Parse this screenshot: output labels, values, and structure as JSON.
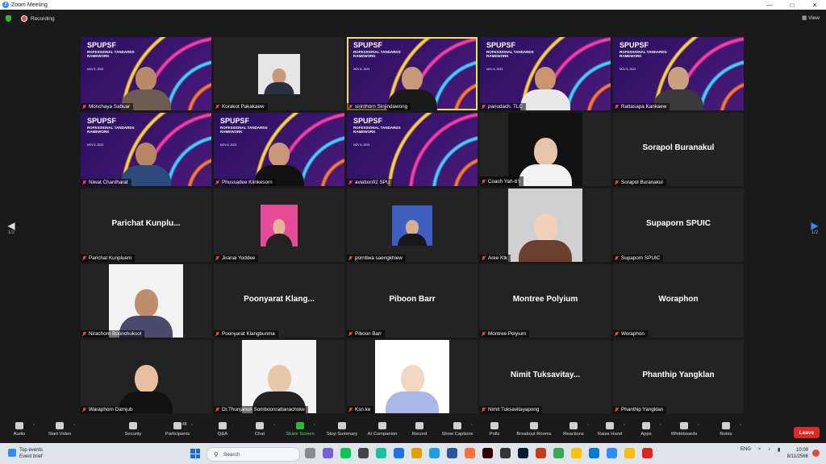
{
  "window": {
    "title": "Zoom Meeting"
  },
  "topbar": {
    "recording_label": "Recording",
    "view_label": "View"
  },
  "pager": {
    "page": "1/2"
  },
  "spu_banner": {
    "title": "SPUPSF",
    "subtitle": "ROFESSIONAL TANDARDS RAMEWORK",
    "date": "NOV 6, 2023"
  },
  "participants": [
    {
      "name": "Monchaya Sabuar",
      "kind": "spu",
      "person": {
        "skin": "#b98a6a",
        "shirt": "#6b5b50"
      }
    },
    {
      "name": "Korakot Pakakaew",
      "kind": "photo",
      "photo": {
        "w": 52,
        "h": 50,
        "bg": "#e6e6e6",
        "skin": "#c79a7a",
        "shirt": "#2a3240"
      }
    },
    {
      "name": "sirinthorn Sinjindawong",
      "kind": "spu",
      "active": true,
      "person": {
        "skin": "#c89a7a",
        "shirt": "#1a1a1a"
      }
    },
    {
      "name": "panudach. TLC",
      "kind": "spu",
      "person": {
        "skin": "#c8956f",
        "shirt": "#e8e8e8"
      }
    },
    {
      "name": "Rattasapa Kankaew",
      "kind": "spu",
      "person": {
        "skin": "#caa080",
        "shirt": "#3a3a3a"
      }
    },
    {
      "name": "Niwat Chantharat",
      "kind": "spu",
      "person": {
        "skin": "#b88563",
        "shirt": "#2d4a7a"
      }
    },
    {
      "name": "Phussadee Klinkesorn",
      "kind": "spu",
      "person": {
        "skin": "#c89878",
        "shirt": "#111111"
      }
    },
    {
      "name": "aviation02 SPU",
      "kind": "spu"
    },
    {
      "name": "Coach Yah-ยา",
      "kind": "photo",
      "photo": {
        "w": 92,
        "h": 91,
        "bg": "#111111",
        "skin": "#e8c4a8",
        "shirt": "#f2f2f2"
      }
    },
    {
      "name": "Sorapol Buranakul",
      "kind": "name",
      "big": "Sorapol Buranakul"
    },
    {
      "name": "Parichat Kunpluem",
      "kind": "name",
      "big": "Parichat  Kunplu..."
    },
    {
      "name": "Jiranai Yoddee",
      "kind": "photo",
      "photo": {
        "w": 46,
        "h": 52,
        "bg": "#e84a9a",
        "skin": "#e0b898",
        "shirt": "#222222"
      }
    },
    {
      "name": "porntiwa saengkhiew",
      "kind": "photo",
      "photo": {
        "w": 50,
        "h": 50,
        "bg": "#4060c0",
        "skin": "#d8b090",
        "shirt": "#181818"
      }
    },
    {
      "name": "Aree Ktk",
      "kind": "photo",
      "photo": {
        "w": 92,
        "h": 91,
        "bg": "#d0d0d0",
        "skin": "#f0d0b8",
        "shirt": "#6a4030"
      }
    },
    {
      "name": "Supaporn SPUIC",
      "kind": "name",
      "big": "Supaporn SPUIC"
    },
    {
      "name": "Nirachorn Boonchuksol",
      "kind": "photo",
      "photo": {
        "w": 92,
        "h": 91,
        "bg": "#f2f2f2",
        "skin": "#c08e6e",
        "shirt": "#4a4a6a"
      }
    },
    {
      "name": "Poonyarat Klangbunma",
      "kind": "name",
      "big": "Poonyarat  Klang..."
    },
    {
      "name": "Piboon Barr",
      "kind": "name",
      "big": "Piboon Barr"
    },
    {
      "name": "Montree Polyium",
      "kind": "name",
      "big": "Montree Polyium"
    },
    {
      "name": "Woraphon",
      "kind": "name",
      "big": "Woraphon"
    },
    {
      "name": "Waraphorn Damjub",
      "kind": "photo",
      "photo": {
        "w": 92,
        "h": 91,
        "bg": "#222222",
        "skin": "#e8c0a0",
        "shirt": "#111111"
      }
    },
    {
      "name": "Dr.Thunjanun Somboonrattanachoke",
      "kind": "photo",
      "photo": {
        "w": 92,
        "h": 91,
        "bg": "#f4f4f4",
        "skin": "#e8c6a8",
        "shirt": "#222222"
      }
    },
    {
      "name": "Ksn.ke",
      "kind": "photo",
      "photo": {
        "w": 92,
        "h": 91,
        "bg": "#ffffff",
        "skin": "#f2d6c0",
        "shirt": "#a8b8e8"
      }
    },
    {
      "name": "Nimit Tuksavitayapong",
      "kind": "name",
      "big": "Nimit  Tuksavitay..."
    },
    {
      "name": "Phanthip Yangklan",
      "kind": "name",
      "big": "Phanthip Yangklan"
    }
  ],
  "toolbar": [
    {
      "key": "audio",
      "label": "Audio",
      "icon": "microphone-icon",
      "caret": true
    },
    {
      "key": "video",
      "label": "Start Video",
      "icon": "video-camera-icon",
      "caret": true
    },
    {
      "key": "security",
      "label": "Security",
      "icon": "shield-icon"
    },
    {
      "key": "participants",
      "label": "Participants",
      "icon": "participants-icon",
      "count": "48",
      "caret": true
    },
    {
      "key": "qa",
      "label": "Q&A",
      "icon": "qa-icon"
    },
    {
      "key": "chat",
      "label": "Chat",
      "icon": "chat-icon",
      "caret": true
    },
    {
      "key": "share",
      "label": "Share Screen",
      "icon": "share-screen-icon",
      "caret": true
    },
    {
      "key": "summary",
      "label": "Stop Summary",
      "icon": "summary-icon"
    },
    {
      "key": "ai",
      "label": "AI Companion",
      "icon": "ai-sparkle-icon"
    },
    {
      "key": "record",
      "label": "Record",
      "icon": "record-icon"
    },
    {
      "key": "captions",
      "label": "Show Captions",
      "icon": "captions-icon",
      "caret": true
    },
    {
      "key": "polls",
      "label": "Polls",
      "icon": "polls-icon"
    },
    {
      "key": "breakout",
      "label": "Breakout Rooms",
      "icon": "breakout-icon"
    },
    {
      "key": "reactions",
      "label": "Reactions",
      "icon": "reaction-icon",
      "caret": true
    },
    {
      "key": "raise",
      "label": "Raise Hand",
      "icon": "hand-icon",
      "caret": true
    },
    {
      "key": "apps",
      "label": "Apps",
      "icon": "apps-icon",
      "caret": true
    },
    {
      "key": "whiteboards",
      "label": "Whiteboards",
      "icon": "whiteboard-icon",
      "caret": true
    },
    {
      "key": "notes",
      "label": "Notes",
      "icon": "notes-icon",
      "caret": true
    }
  ],
  "leave": {
    "label": "Leave"
  },
  "taskbar": {
    "event_title": "Top events",
    "event_sub": "Event brief",
    "search_placeholder": "Search",
    "lang": "ENG",
    "time": "10:09",
    "date": "8/11/2566",
    "apps": [
      {
        "name": "file-explorer-icon",
        "color": "#8a8a8a"
      },
      {
        "name": "meet-icon",
        "color": "#7b5cd6"
      },
      {
        "name": "line-icon",
        "color": "#06c755"
      },
      {
        "name": "files-icon",
        "color": "#444444"
      },
      {
        "name": "grammarly-icon",
        "color": "#15c39a"
      },
      {
        "name": "maps-icon",
        "color": "#1a73e8"
      },
      {
        "name": "chrome-icon",
        "color": "#e0a000"
      },
      {
        "name": "edge-icon",
        "color": "#1ba1e2"
      },
      {
        "name": "word-icon",
        "color": "#2b579a"
      },
      {
        "name": "firefox-icon",
        "color": "#ff7139"
      },
      {
        "name": "illustrator-icon",
        "color": "#330000"
      },
      {
        "name": "unity-icon",
        "color": "#333333"
      },
      {
        "name": "photoshop-icon",
        "color": "#001e36"
      },
      {
        "name": "powerpoint-icon",
        "color": "#c43e1c"
      },
      {
        "name": "chrome2-icon",
        "color": "#34a853"
      },
      {
        "name": "folder-icon",
        "color": "#f8c400"
      },
      {
        "name": "mail-icon",
        "color": "#0078d4"
      },
      {
        "name": "zoom-icon",
        "color": "#2d8cff"
      },
      {
        "name": "chrome3-icon",
        "color": "#fbbc05"
      },
      {
        "name": "acrobat-icon",
        "color": "#d9261c"
      }
    ]
  }
}
